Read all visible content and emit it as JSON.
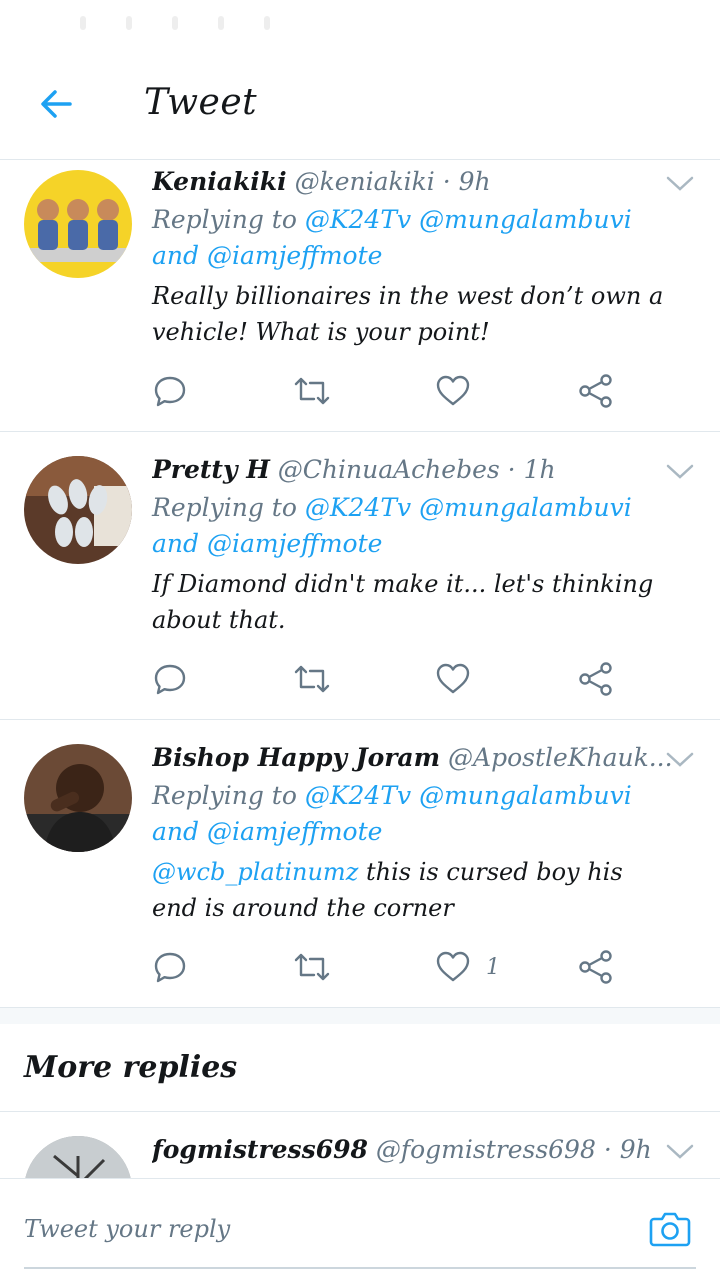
{
  "header": {
    "title": "Tweet"
  },
  "tweets": [
    {
      "name": "Keniakiki",
      "handle": "@keniakiki",
      "time": "9h",
      "replying_prefix": "Replying to",
      "replying_to": [
        "@K24Tv",
        "@mungalambuvi"
      ],
      "replying_and": "and",
      "replying_last": "@iamjeffmote",
      "text": "Really billionaires in the west don’t own a vehicle! What is your point!",
      "likes": ""
    },
    {
      "name": "Pretty H",
      "handle": "@ChinuaAchebes",
      "time": "1h",
      "replying_prefix": "Replying to",
      "replying_to": [
        "@K24Tv",
        "@mungalambuvi"
      ],
      "replying_and": "and",
      "replying_last": "@iamjeffmote",
      "text": "If Diamond didn't make it... let's thinking about that.",
      "likes": ""
    },
    {
      "name": "Bishop Happy Joram",
      "handle": "@ApostleKhauk...",
      "time": "9h",
      "replying_prefix": "Replying to",
      "replying_to": [
        "@K24Tv",
        "@mungalambuvi"
      ],
      "replying_and": "and",
      "replying_last": "@iamjeffmote",
      "text_mention": "@wcb_platinumz",
      "text": " this is cursed boy his end is around the corner",
      "likes": "1"
    }
  ],
  "more_replies": {
    "title": "More replies",
    "first": {
      "name": "fogmistress698",
      "handle": "@fogmistress698",
      "time": "9h"
    }
  },
  "reply_bar": {
    "placeholder": "Tweet your reply"
  },
  "colors": {
    "accent": "#1da1f2",
    "muted": "#657786",
    "divider": "#e1e8ed"
  },
  "icons": [
    "back-arrow-icon",
    "chevron-down-icon",
    "reply-icon",
    "retweet-icon",
    "like-icon",
    "share-icon",
    "camera-icon"
  ]
}
